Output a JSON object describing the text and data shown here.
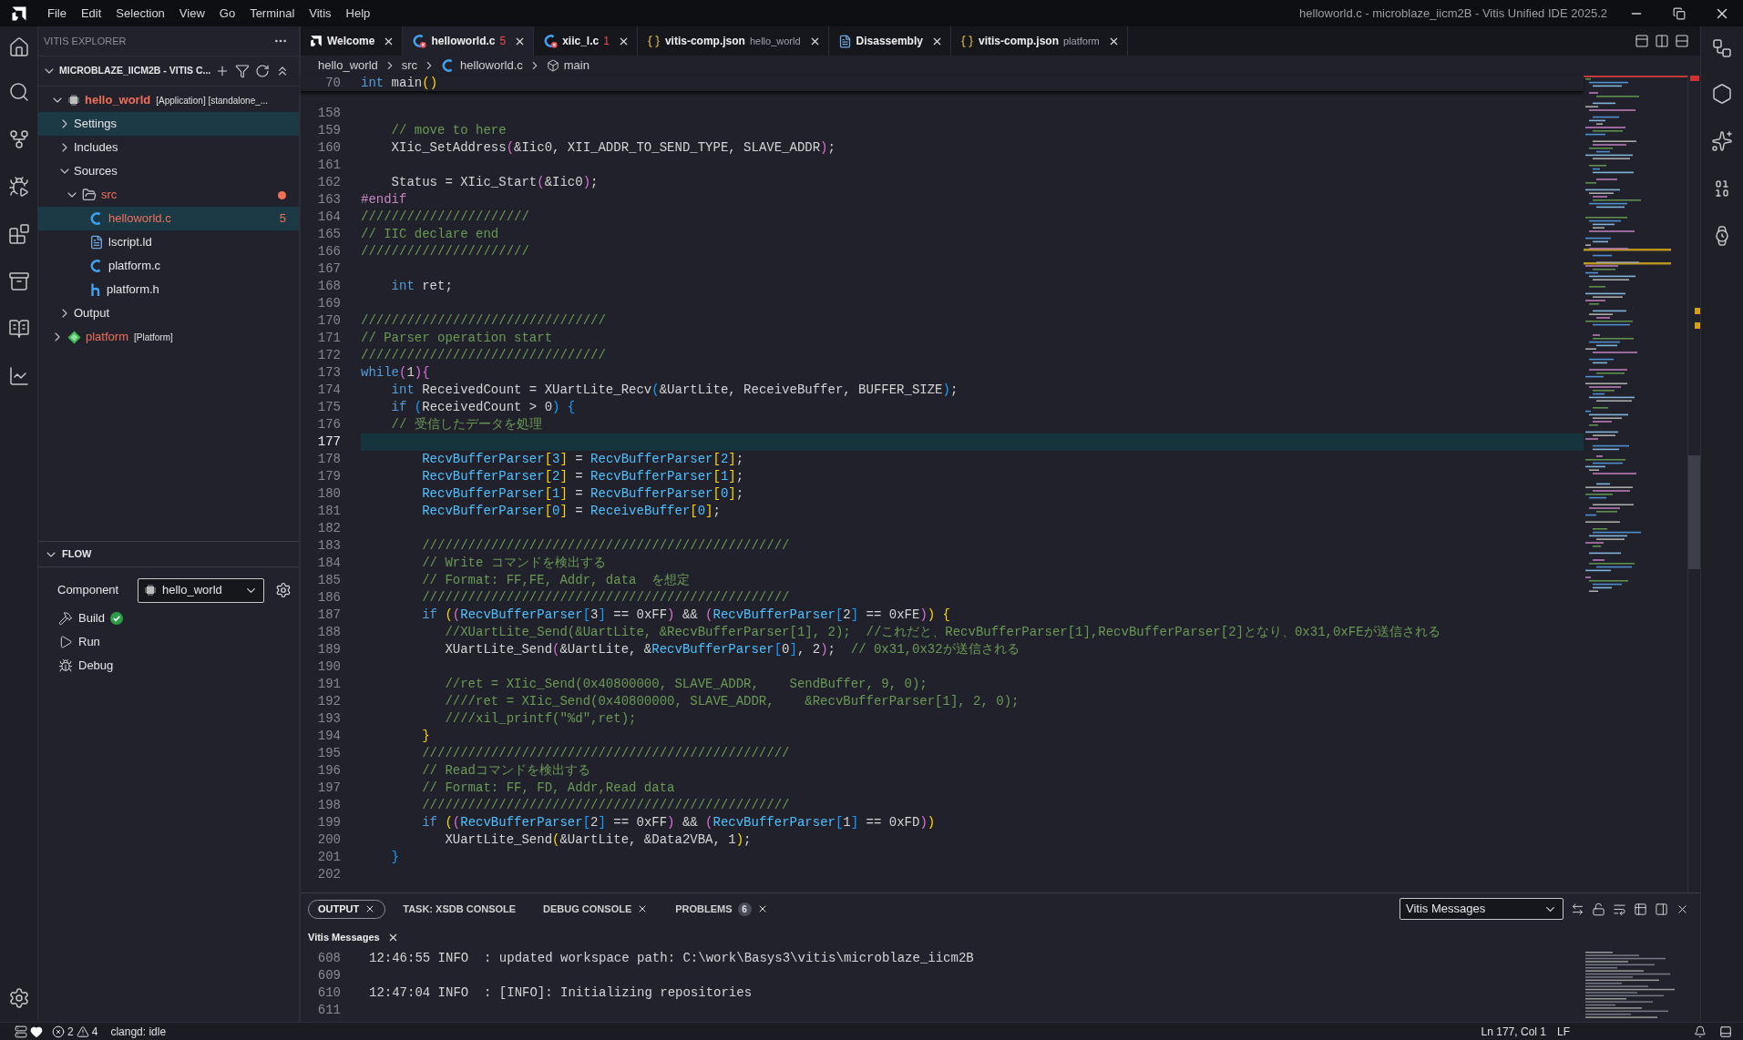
{
  "window": {
    "title": "helloworld.c - microblaze_iicm2B - Vitis Unified IDE 2025.2"
  },
  "menu": [
    "File",
    "Edit",
    "Selection",
    "View",
    "Go",
    "Terminal",
    "Vitis",
    "Help"
  ],
  "explorer": {
    "title": "VITIS EXPLORER",
    "workspace": {
      "label": "MICROBLAZE_IICM2B - VITIS C...",
      "expanded": true
    },
    "tree": [
      {
        "kind": "application",
        "label": "hello_world",
        "detail": "[Application] [standalone_...",
        "active": true,
        "error": true,
        "selected": false,
        "expanded": true,
        "children": [
          {
            "label": "Settings",
            "error": false,
            "selected": true,
            "expanded": false
          },
          {
            "label": "Includes",
            "error": false,
            "selected": false,
            "expanded": false
          },
          {
            "label": "Sources",
            "error": false,
            "selected": false,
            "expanded": true,
            "children": [
              {
                "kind": "folder",
                "label": "src",
                "error": true,
                "dot": true,
                "selected": false,
                "expanded": true,
                "children": [
                  {
                    "kind": "c",
                    "label": "helloworld.c",
                    "error": true,
                    "badge": "5",
                    "selected": true
                  },
                  {
                    "kind": "linker",
                    "label": "lscript.ld",
                    "error": false,
                    "selected": false
                  },
                  {
                    "kind": "c",
                    "label": "platform.c",
                    "error": false,
                    "selected": false
                  },
                  {
                    "kind": "h",
                    "label": "platform.h",
                    "error": false,
                    "selected": false
                  }
                ]
              }
            ]
          },
          {
            "label": "Output",
            "error": false,
            "selected": false,
            "expanded": false
          }
        ]
      },
      {
        "kind": "platform",
        "label": "platform",
        "detail": "[Platform]",
        "active": false,
        "error": true,
        "selected": false,
        "expanded": false
      }
    ]
  },
  "flow": {
    "title": "FLOW",
    "expanded": true,
    "component_label": "Component",
    "component": "hello_world",
    "actions": [
      {
        "kind": "build",
        "label": "Build",
        "succeeded": true
      },
      {
        "kind": "run",
        "label": "Run",
        "succeeded": false
      },
      {
        "kind": "debug",
        "label": "Debug",
        "succeeded": false
      }
    ]
  },
  "tabs": [
    {
      "kind": "welcome",
      "label": "Welcome",
      "selected": false
    },
    {
      "kind": "c",
      "label": "helloworld.c",
      "problems": "5",
      "selected": true
    },
    {
      "kind": "c",
      "label": "xiic_l.c",
      "problems": "1",
      "selected": false
    },
    {
      "kind": "json",
      "label": "vitis-comp.json",
      "description": "hello_world",
      "selected": false
    },
    {
      "kind": "document",
      "label": "Disassembly",
      "selected": false
    },
    {
      "kind": "json",
      "label": "vitis-comp.json",
      "description": "platform",
      "selected": false
    }
  ],
  "breadcrumb": [
    {
      "kind": "folder",
      "label": "hello_world"
    },
    {
      "kind": "folder",
      "label": "src"
    },
    {
      "kind": "c",
      "label": "helloworld.c"
    },
    {
      "kind": "function",
      "label": "main"
    }
  ],
  "editor": {
    "sticky": {
      "number": "70",
      "tokens": [
        {
          "kind": "keyword",
          "text": "int"
        },
        {
          "kind": "plain",
          "text": " main"
        },
        {
          "kind": "bracket1",
          "text": "()"
        }
      ]
    },
    "lines": [
      {
        "number": "158",
        "current": false
      },
      {
        "number": "159",
        "current": false,
        "tokens": [
          {
            "kind": "comment",
            "text": "    // move to here"
          }
        ]
      },
      {
        "number": "160",
        "current": false,
        "tokens": [
          {
            "kind": "plain",
            "text": "    XIic_SetAddress"
          },
          {
            "kind": "bracket2",
            "text": "("
          },
          {
            "kind": "plain",
            "text": "&Iic0, XII_ADDR_TO_SEND_TYPE, SLAVE_ADDR"
          },
          {
            "kind": "bracket2",
            "text": ")"
          },
          {
            "kind": "plain",
            "text": ";"
          }
        ]
      },
      {
        "number": "161",
        "current": false
      },
      {
        "number": "162",
        "current": false,
        "tokens": [
          {
            "kind": "plain",
            "text": "    Status = XIic_Start"
          },
          {
            "kind": "bracket2",
            "text": "("
          },
          {
            "kind": "plain",
            "text": "&Iic0"
          },
          {
            "kind": "bracket2",
            "text": ")"
          },
          {
            "kind": "plain",
            "text": ";"
          }
        ]
      },
      {
        "number": "163",
        "current": false,
        "tokens": [
          {
            "kind": "preproc",
            "text": "#endif"
          }
        ]
      },
      {
        "number": "164",
        "current": false,
        "tokens": [
          {
            "kind": "comment",
            "text": "//////////////////////"
          }
        ]
      },
      {
        "number": "165",
        "current": false,
        "tokens": [
          {
            "kind": "comment",
            "text": "// IIC declare end"
          }
        ]
      },
      {
        "number": "166",
        "current": false,
        "tokens": [
          {
            "kind": "comment",
            "text": "//////////////////////"
          }
        ]
      },
      {
        "number": "167",
        "current": false
      },
      {
        "number": "168",
        "current": false,
        "tokens": [
          {
            "kind": "keyword",
            "text": "    int"
          },
          {
            "kind": "plain",
            "text": " ret;"
          }
        ]
      },
      {
        "number": "169",
        "current": false
      },
      {
        "number": "170",
        "current": false,
        "tokens": [
          {
            "kind": "comment",
            "text": "////////////////////////////////"
          }
        ]
      },
      {
        "number": "171",
        "current": false,
        "tokens": [
          {
            "kind": "comment",
            "text": "// Parser operation start"
          }
        ]
      },
      {
        "number": "172",
        "current": false,
        "tokens": [
          {
            "kind": "comment",
            "text": "////////////////////////////////"
          }
        ]
      },
      {
        "number": "173",
        "current": false,
        "tokens": [
          {
            "kind": "keyword",
            "text": "while"
          },
          {
            "kind": "bracket2",
            "text": "("
          },
          {
            "kind": "plain",
            "text": "1"
          },
          {
            "kind": "bracket2",
            "text": "){"
          }
        ]
      },
      {
        "number": "174",
        "current": false,
        "tokens": [
          {
            "kind": "keyword",
            "text": "    int"
          },
          {
            "kind": "plain",
            "text": " ReceivedCount = XUartLite_Recv"
          },
          {
            "kind": "bracket3",
            "text": "("
          },
          {
            "kind": "plain",
            "text": "&UartLite, ReceiveBuffer, BUFFER_SIZE"
          },
          {
            "kind": "bracket3",
            "text": ")"
          },
          {
            "kind": "plain",
            "text": ";"
          }
        ]
      },
      {
        "number": "175",
        "current": false,
        "tokens": [
          {
            "kind": "keyword",
            "text": "    if"
          },
          {
            "kind": "bracket3",
            "text": " ("
          },
          {
            "kind": "plain",
            "text": "ReceivedCount > 0"
          },
          {
            "kind": "bracket3",
            "text": ") {"
          }
        ]
      },
      {
        "number": "176",
        "current": false,
        "tokens": [
          {
            "kind": "comment",
            "text": "    // 受信したデータを処理"
          }
        ]
      },
      {
        "number": "177",
        "current": true
      },
      {
        "number": "178",
        "current": false,
        "tokens": [
          {
            "kind": "variable",
            "text": "        RecvBufferParser"
          },
          {
            "kind": "bracket1",
            "text": "["
          },
          {
            "kind": "variable",
            "text": "3"
          },
          {
            "kind": "bracket1",
            "text": "]"
          },
          {
            "kind": "plain",
            "text": " = "
          },
          {
            "kind": "variable",
            "text": "RecvBufferParser"
          },
          {
            "kind": "bracket1",
            "text": "["
          },
          {
            "kind": "variable",
            "text": "2"
          },
          {
            "kind": "bracket1",
            "text": "]"
          },
          {
            "kind": "plain",
            "text": ";"
          }
        ]
      },
      {
        "number": "179",
        "current": false,
        "tokens": [
          {
            "kind": "variable",
            "text": "        RecvBufferParser"
          },
          {
            "kind": "bracket1",
            "text": "["
          },
          {
            "kind": "variable",
            "text": "2"
          },
          {
            "kind": "bracket1",
            "text": "]"
          },
          {
            "kind": "plain",
            "text": " = "
          },
          {
            "kind": "variable",
            "text": "RecvBufferParser"
          },
          {
            "kind": "bracket1",
            "text": "["
          },
          {
            "kind": "variable",
            "text": "1"
          },
          {
            "kind": "bracket1",
            "text": "]"
          },
          {
            "kind": "plain",
            "text": ";"
          }
        ]
      },
      {
        "number": "180",
        "current": false,
        "tokens": [
          {
            "kind": "variable",
            "text": "        RecvBufferParser"
          },
          {
            "kind": "bracket1",
            "text": "["
          },
          {
            "kind": "variable",
            "text": "1"
          },
          {
            "kind": "bracket1",
            "text": "]"
          },
          {
            "kind": "plain",
            "text": " = "
          },
          {
            "kind": "variable",
            "text": "RecvBufferParser"
          },
          {
            "kind": "bracket1",
            "text": "["
          },
          {
            "kind": "variable",
            "text": "0"
          },
          {
            "kind": "bracket1",
            "text": "]"
          },
          {
            "kind": "plain",
            "text": ";"
          }
        ]
      },
      {
        "number": "181",
        "current": false,
        "tokens": [
          {
            "kind": "variable",
            "text": "        RecvBufferParser"
          },
          {
            "kind": "bracket1",
            "text": "["
          },
          {
            "kind": "variable",
            "text": "0"
          },
          {
            "kind": "bracket1",
            "text": "]"
          },
          {
            "kind": "plain",
            "text": " = "
          },
          {
            "kind": "variable",
            "text": "ReceiveBuffer"
          },
          {
            "kind": "bracket1",
            "text": "["
          },
          {
            "kind": "variable",
            "text": "0"
          },
          {
            "kind": "bracket1",
            "text": "]"
          },
          {
            "kind": "plain",
            "text": ";"
          }
        ]
      },
      {
        "number": "182",
        "current": false
      },
      {
        "number": "183",
        "current": false,
        "tokens": [
          {
            "kind": "comment",
            "text": "        ////////////////////////////////////////////////"
          }
        ]
      },
      {
        "number": "184",
        "current": false,
        "tokens": [
          {
            "kind": "comment",
            "text": "        // Write コマンドを検出する"
          }
        ]
      },
      {
        "number": "185",
        "current": false,
        "tokens": [
          {
            "kind": "comment",
            "text": "        // Format: FF,FE, Addr, data  を想定"
          }
        ]
      },
      {
        "number": "186",
        "current": false,
        "tokens": [
          {
            "kind": "comment",
            "text": "        ////////////////////////////////////////////////"
          }
        ]
      },
      {
        "number": "187",
        "current": false,
        "tokens": [
          {
            "kind": "keyword",
            "text": "        if"
          },
          {
            "kind": "bracket1",
            "text": " ("
          },
          {
            "kind": "bracket2",
            "text": "("
          },
          {
            "kind": "variable",
            "text": "RecvBufferParser"
          },
          {
            "kind": "bracket3",
            "text": "["
          },
          {
            "kind": "plain",
            "text": "3"
          },
          {
            "kind": "bracket3",
            "text": "]"
          },
          {
            "kind": "plain",
            "text": " == 0xFF"
          },
          {
            "kind": "bracket2",
            "text": ")"
          },
          {
            "kind": "plain",
            "text": " && "
          },
          {
            "kind": "bracket2",
            "text": "("
          },
          {
            "kind": "variable",
            "text": "RecvBufferParser"
          },
          {
            "kind": "bracket3",
            "text": "["
          },
          {
            "kind": "plain",
            "text": "2"
          },
          {
            "kind": "bracket3",
            "text": "]"
          },
          {
            "kind": "plain",
            "text": " == 0xFE"
          },
          {
            "kind": "bracket2",
            "text": ")"
          },
          {
            "kind": "bracket1",
            "text": ") {"
          }
        ]
      },
      {
        "number": "188",
        "current": false,
        "tokens": [
          {
            "kind": "comment",
            "text": "           //XUartLite_Send(&UartLite, &RecvBufferParser[1], 2);  //これだと、RecvBufferParser[1],RecvBufferParser[2]となり、0x31,0xFEが送信される"
          }
        ]
      },
      {
        "number": "189",
        "current": false,
        "tokens": [
          {
            "kind": "plain",
            "text": "           XUartLite_Send"
          },
          {
            "kind": "bracket2",
            "text": "("
          },
          {
            "kind": "plain",
            "text": "&UartLite, &"
          },
          {
            "kind": "variable",
            "text": "RecvBufferParser"
          },
          {
            "kind": "bracket3",
            "text": "["
          },
          {
            "kind": "plain",
            "text": "0"
          },
          {
            "kind": "bracket3",
            "text": "]"
          },
          {
            "kind": "plain",
            "text": ", 2"
          },
          {
            "kind": "bracket2",
            "text": ")"
          },
          {
            "kind": "plain",
            "text": ";  "
          },
          {
            "kind": "comment",
            "text": "// 0x31,0x32が送信される"
          }
        ]
      },
      {
        "number": "190",
        "current": false
      },
      {
        "number": "191",
        "current": false,
        "tokens": [
          {
            "kind": "comment",
            "text": "           //ret = XIic_Send(0x40800000, SLAVE_ADDR,    SendBuffer, 9, 0);"
          }
        ]
      },
      {
        "number": "192",
        "current": false,
        "tokens": [
          {
            "kind": "comment",
            "text": "           ////ret = XIic_Send(0x40800000, SLAVE_ADDR,    &RecvBufferParser[1], 2, 0);"
          }
        ]
      },
      {
        "number": "193",
        "current": false,
        "tokens": [
          {
            "kind": "comment",
            "text": "           ////xil_printf(\"%d\",ret);"
          }
        ]
      },
      {
        "number": "194",
        "current": false,
        "tokens": [
          {
            "kind": "bracket1",
            "text": "        }"
          }
        ]
      },
      {
        "number": "195",
        "current": false,
        "tokens": [
          {
            "kind": "comment",
            "text": "        ////////////////////////////////////////////////"
          }
        ]
      },
      {
        "number": "196",
        "current": false,
        "tokens": [
          {
            "kind": "comment",
            "text": "        // Readコマンドを検出する"
          }
        ]
      },
      {
        "number": "197",
        "current": false,
        "tokens": [
          {
            "kind": "comment",
            "text": "        // Format: FF, FD, Addr,Read data"
          }
        ]
      },
      {
        "number": "198",
        "current": false,
        "tokens": [
          {
            "kind": "comment",
            "text": "        ////////////////////////////////////////////////"
          }
        ]
      },
      {
        "number": "199",
        "current": false,
        "tokens": [
          {
            "kind": "keyword",
            "text": "        if"
          },
          {
            "kind": "bracket1",
            "text": " ("
          },
          {
            "kind": "bracket2",
            "text": "("
          },
          {
            "kind": "variable",
            "text": "RecvBufferParser"
          },
          {
            "kind": "bracket3",
            "text": "["
          },
          {
            "kind": "plain",
            "text": "2"
          },
          {
            "kind": "bracket3",
            "text": "]"
          },
          {
            "kind": "plain",
            "text": " == 0xFF"
          },
          {
            "kind": "bracket2",
            "text": ")"
          },
          {
            "kind": "plain",
            "text": " && "
          },
          {
            "kind": "bracket2",
            "text": "("
          },
          {
            "kind": "variable",
            "text": "RecvBufferParser"
          },
          {
            "kind": "bracket3",
            "text": "["
          },
          {
            "kind": "plain",
            "text": "1"
          },
          {
            "kind": "bracket3",
            "text": "]"
          },
          {
            "kind": "plain",
            "text": " == 0xFD"
          },
          {
            "kind": "bracket2",
            "text": ")"
          },
          {
            "kind": "bracket1",
            "text": ")"
          }
        ]
      },
      {
        "number": "200",
        "current": false,
        "tokens": [
          {
            "kind": "plain",
            "text": "           XUartLite_Send"
          },
          {
            "kind": "bracket1",
            "text": "("
          },
          {
            "kind": "plain",
            "text": "&UartLite, &Data2VBA, 1"
          },
          {
            "kind": "bracket1",
            "text": ")"
          },
          {
            "kind": "plain",
            "text": ";"
          }
        ]
      },
      {
        "number": "201",
        "current": false,
        "tokens": [
          {
            "kind": "bracket3",
            "text": "    }"
          }
        ]
      },
      {
        "number": "202",
        "current": false
      }
    ]
  },
  "panel": {
    "tabs": [
      {
        "label": "OUTPUT",
        "selected": true,
        "closable": true
      },
      {
        "label": "TASK: XSDB CONSOLE",
        "selected": false,
        "closable": false
      },
      {
        "label": "DEBUG CONSOLE",
        "selected": false,
        "closable": true
      },
      {
        "label": "PROBLEMS",
        "badge": "6",
        "selected": false,
        "closable": true
      }
    ],
    "channel": "Vitis Messages",
    "view_title": "Vitis Messages",
    "lines": [
      {
        "number": "608",
        "text": "12:46:55 INFO  : updated workspace path: C:\\work\\Basys3\\vitis\\microblaze_iicm2B"
      },
      {
        "number": "609"
      },
      {
        "number": "610",
        "text": "12:47:04 INFO  : [INFO]: Initializing repositories"
      },
      {
        "number": "611"
      }
    ]
  },
  "status_bar": {
    "errors": "2",
    "warnings": "4",
    "language_server": "clangd: idle",
    "cursor": "Ln 177, Col 1",
    "eol": "LF"
  }
}
